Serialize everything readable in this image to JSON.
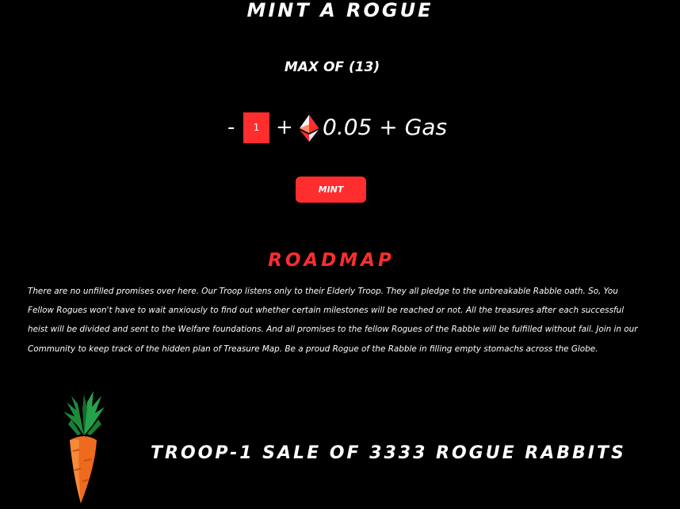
{
  "mint": {
    "title": "MINT A ROGUE",
    "max_label": "MAX OF (13)",
    "minus_label": "-",
    "plus_label": "+",
    "quantity": "1",
    "price": "0.05 + Gas",
    "currency_icon": "ethereum-icon",
    "button_label": "MINT"
  },
  "roadmap": {
    "title": "ROADMAP",
    "body": "There are no unfilled promises over here. Our Troop listens only to their Elderly Troop. They all pledge to the unbreakable Rabble oath. So, You Fellow Rogues won't have to wait anxiously to find out whether certain milestones will be reached or not. All the treasures after each successful heist will be divided and sent to the Welfare foundations. And all promises to the fellow Rogues of the Rabble will be fulfilled without fail. Join in our Community to keep track of the hidden plan of Treasure Map. Be a proud Rogue of the Rabble in filling empty stomachs across the Globe."
  },
  "sale": {
    "title": "TROOP-1 SALE OF 3333 ROGUE RABBITS",
    "illustration": "carrot-icon"
  },
  "colors": {
    "background": "#000000",
    "accent": "#ff2d2d",
    "text": "#ffffff"
  }
}
